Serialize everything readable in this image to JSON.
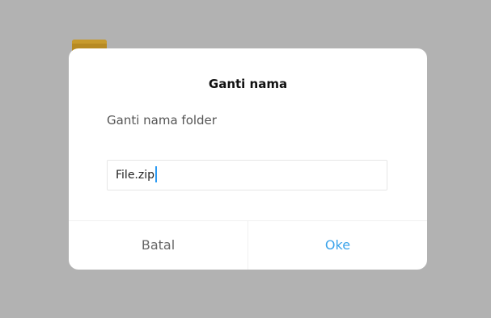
{
  "dialog": {
    "title": "Ganti nama",
    "message": "Ganti nama folder",
    "input_value": "File.zip",
    "cancel_label": "Batal",
    "ok_label": "Oke"
  },
  "colors": {
    "accent": "#3aa3ea",
    "backdrop": "#b2b2b2",
    "caret": "#2b9af3"
  },
  "icons": {
    "background": "folder-icon"
  }
}
